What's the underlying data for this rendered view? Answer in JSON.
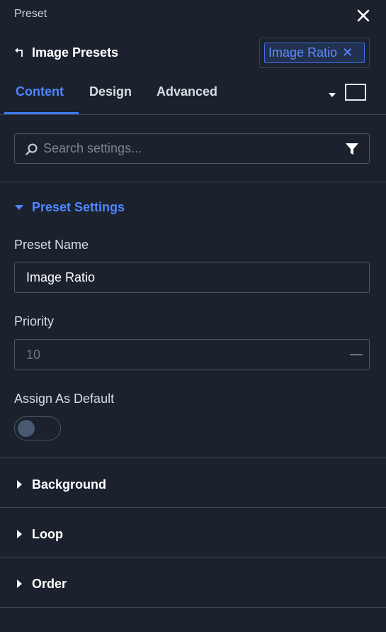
{
  "topbar": {
    "title": "Preset"
  },
  "header": {
    "title": "Image Presets",
    "chip_label": "Image Ratio",
    "chip_close": "✕"
  },
  "tabs": [
    {
      "label": "Content",
      "active": true
    },
    {
      "label": "Design",
      "active": false
    },
    {
      "label": "Advanced",
      "active": false
    }
  ],
  "search": {
    "placeholder": "Search settings...",
    "value": ""
  },
  "preset_settings": {
    "title": "Preset Settings",
    "preset_name_label": "Preset Name",
    "preset_name_value": "Image Ratio",
    "priority_label": "Priority",
    "priority_value": "10",
    "assign_default_label": "Assign As Default",
    "assign_default_on": false
  },
  "sections": [
    {
      "label": "Background"
    },
    {
      "label": "Loop"
    },
    {
      "label": "Order"
    }
  ],
  "colors": {
    "background": "#1b222d",
    "accent": "#3d7bff",
    "border": "#3a4556"
  }
}
